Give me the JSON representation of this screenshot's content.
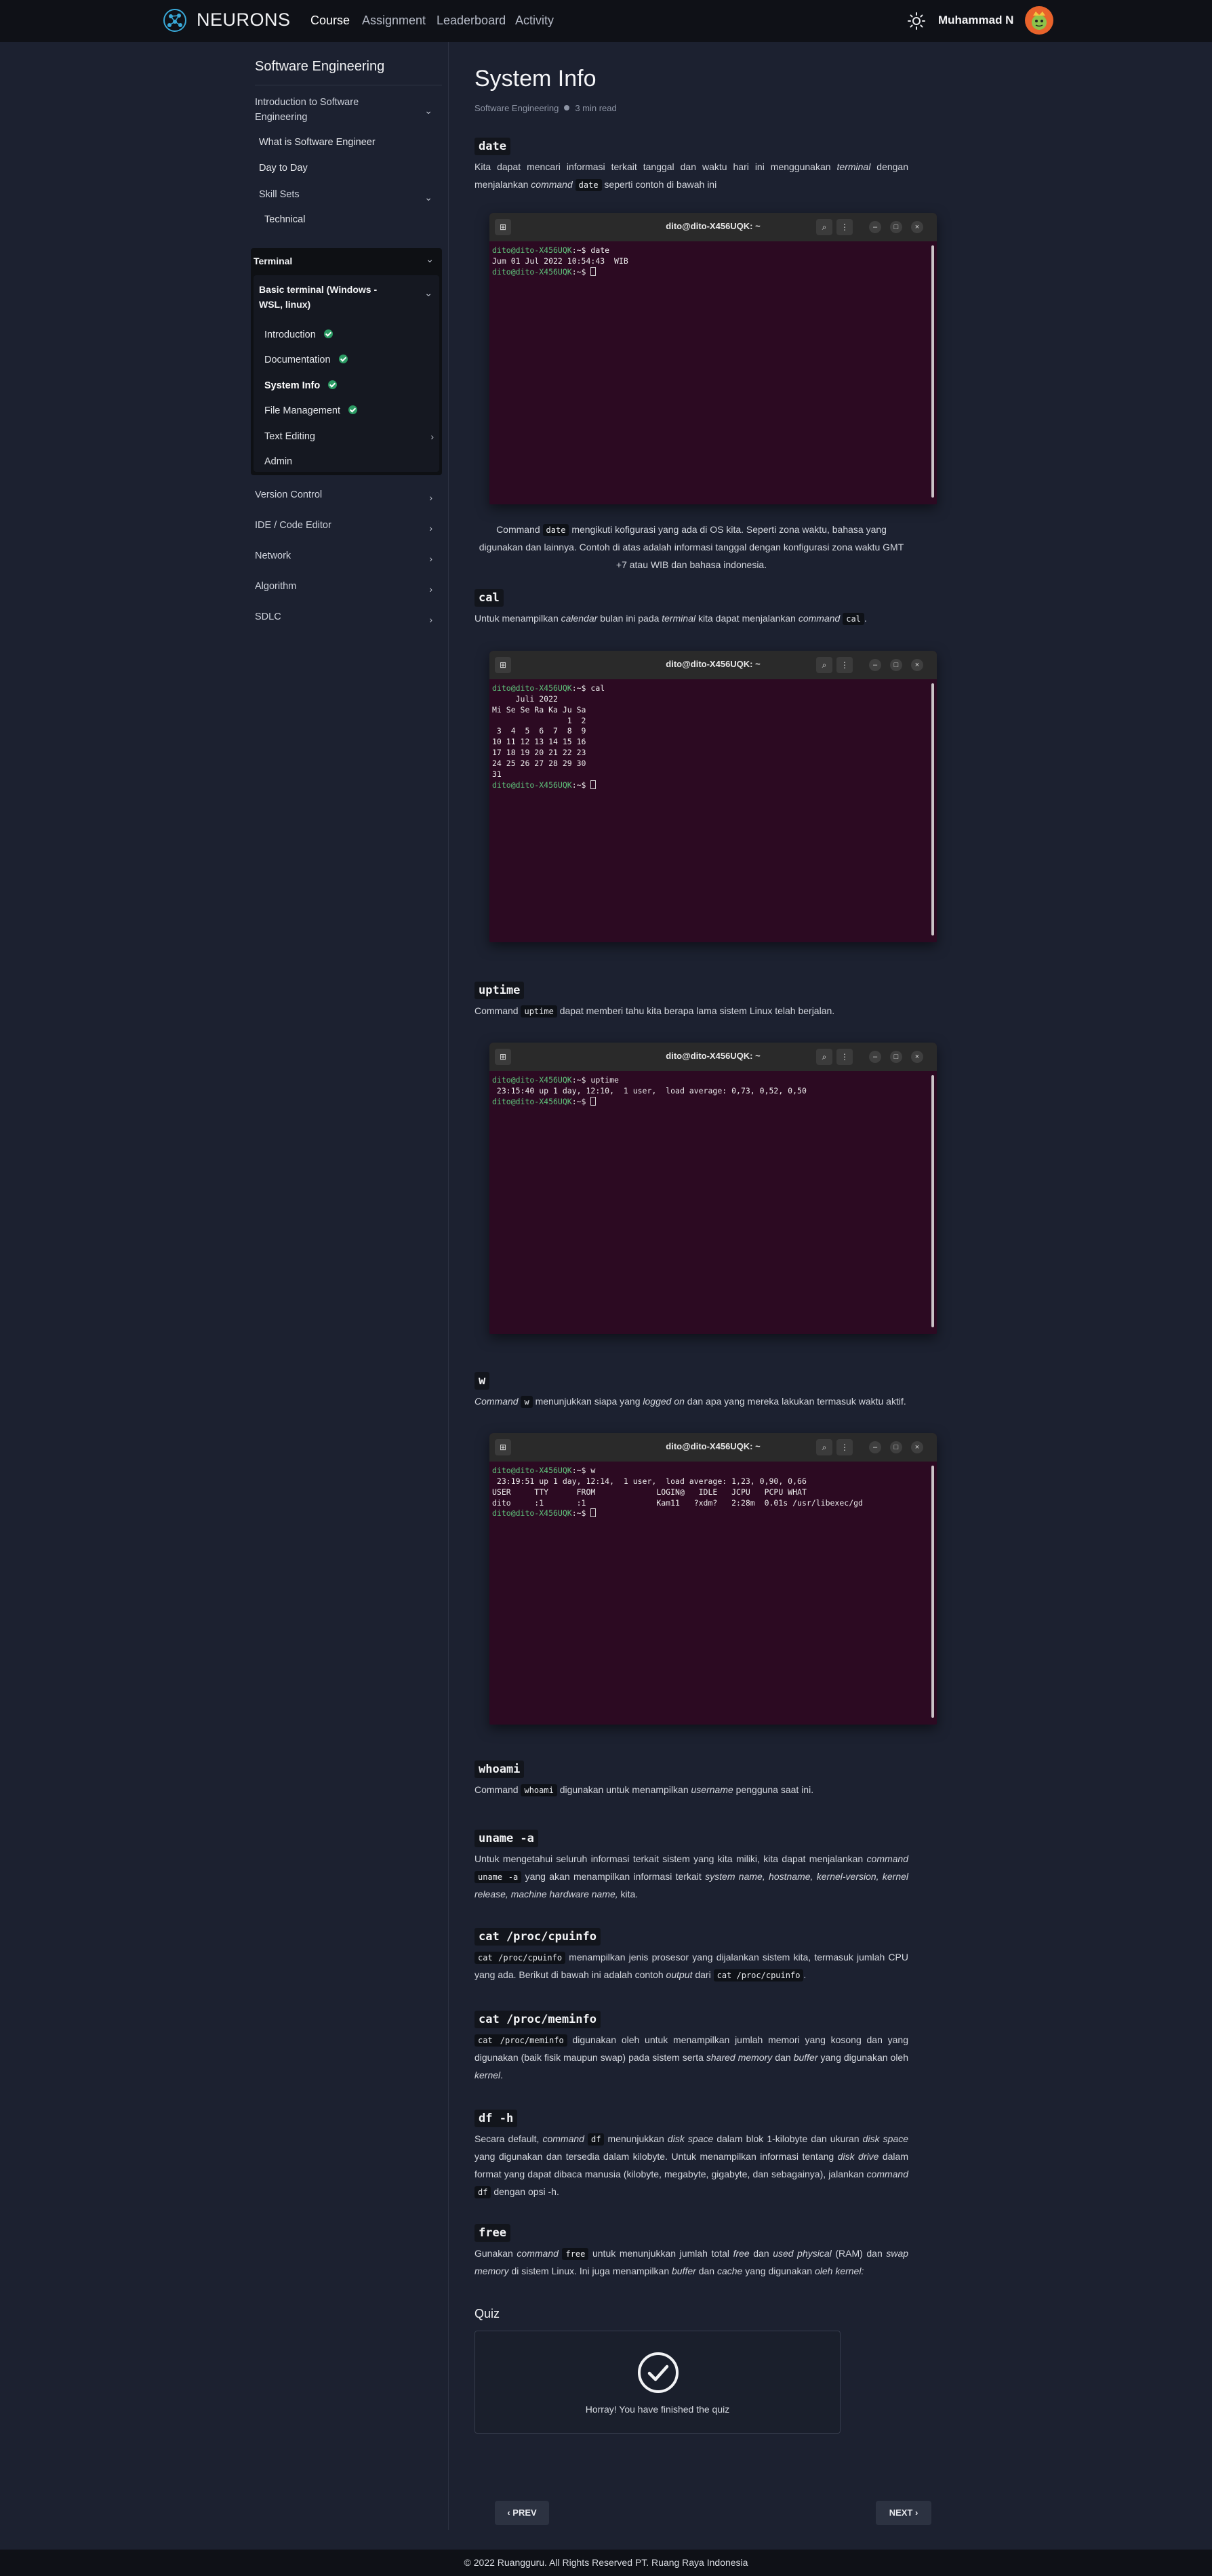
{
  "nav": {
    "brand": "NEURONS",
    "links": [
      "Course",
      "Assignment",
      "Leaderboard",
      "Activity"
    ],
    "user_name": "Muhammad N"
  },
  "sidebar": {
    "title": "Software Engineering",
    "sections": [
      {
        "label": "Introduction to Software Engineering",
        "expanded": true,
        "children": [
          "What is Software Engineer",
          "Day to Day",
          "Skill Sets",
          "Technical"
        ]
      },
      {
        "label": "Terminal",
        "expanded": true
      },
      {
        "label": "Version Control"
      },
      {
        "label": "IDE / Code Editor"
      },
      {
        "label": "Network"
      },
      {
        "label": "Algorithm"
      },
      {
        "label": "SDLC"
      }
    ],
    "terminal_group": "Basic terminal (Windows -WSL, linux)",
    "terminal_items": [
      {
        "label": "Introduction",
        "done": true
      },
      {
        "label": "Documentation",
        "done": true
      },
      {
        "label": "System Info",
        "done": true,
        "active": true
      },
      {
        "label": "File Management",
        "done": true
      },
      {
        "label": "Text Editing",
        "has_children": true
      },
      {
        "label": "Admin"
      }
    ]
  },
  "page": {
    "title": "System Info",
    "breadcrumb": "Software Engineering",
    "read_time": "3 min read"
  },
  "sections": {
    "date": {
      "heading": "date",
      "intro_a": "Kita dapat mencari informasi terkait tanggal dan waktu hari ini menggunakan ",
      "intro_em": "terminal",
      "intro_b": " dengan menjalankan ",
      "intro_em2": "command",
      "intro_code": "date",
      "intro_c": " seperti contoh di bawah ini",
      "caption_a": "Command ",
      "caption_code": "date",
      "caption_b": " mengikuti kofigurasi yang ada di OS kita. Seperti zona waktu, bahasa yang digunakan dan lainnya. Contoh di atas adalah informasi tanggal dengan konfigurasi zona waktu GMT +7 atau WIB dan bahasa indonesia."
    },
    "cal": {
      "heading": "cal",
      "text_a": "Untuk menampilkan ",
      "text_em": "calendar",
      "text_b": " bulan ini pada ",
      "text_em2": "terminal",
      "text_c": " kita dapat menjalankan ",
      "text_em3": "command",
      "text_code": "cal",
      "text_d": "."
    },
    "uptime": {
      "heading": "uptime",
      "text_a": "Command ",
      "text_code": "uptime",
      "text_b": " dapat memberi tahu kita berapa lama sistem Linux telah berjalan."
    },
    "w": {
      "heading": "w",
      "text_em": "Command",
      "text_code": "w",
      "text_a": " menunjukkan siapa yang ",
      "text_em2": "logged on",
      "text_b": " dan apa yang mereka lakukan termasuk waktu aktif."
    },
    "whoami": {
      "heading": "whoami",
      "text_a": "Command ",
      "text_code": "whoami",
      "text_b": " digunakan untuk menampilkan ",
      "text_em": "username",
      "text_c": " pengguna saat ini."
    },
    "uname": {
      "heading": "uname -a",
      "text_a": "Untuk mengetahui seluruh informasi terkait sistem yang kita miliki, kita dapat menjalankan ",
      "text_em": "command",
      "text_code": "uname -a",
      "text_b": " yang akan menampilkan informasi terkait ",
      "text_em2": "system name, hostname, kernel-version, kernel release, machine hardware name,",
      "text_c": " kita."
    },
    "cpuinfo": {
      "heading": "cat /proc/cpuinfo",
      "text_code": "cat /proc/cpuinfo",
      "text_a": " menampilkan jenis prosesor yang dijalankan sistem kita, termasuk jumlah CPU yang ada. Berikut di bawah ini adalah contoh ",
      "text_em": "output",
      "text_b": " dari ",
      "text_code2": "cat /proc/cpuinfo",
      "text_c": "."
    },
    "meminfo": {
      "heading": "cat /proc/meminfo",
      "text_code": "cat /proc/meminfo",
      "text_a": " digunakan oleh untuk menampilkan jumlah memori yang kosong dan yang digunakan (baik fisik maupun swap) pada sistem serta ",
      "text_em": "shared memory",
      "text_b": " dan ",
      "text_em2": "buffer",
      "text_c": " yang digunakan oleh ",
      "text_em3": "kernel",
      "text_d": "."
    },
    "df": {
      "heading": "df -h",
      "text_a": "Secara default, ",
      "text_em": "command",
      "text_code": "df",
      "text_b": " menunjukkan ",
      "text_em2": "disk space",
      "text_c": " dalam blok 1-kilobyte dan ukuran ",
      "text_em3": "disk space",
      "text_d": " yang digunakan dan tersedia dalam kilobyte. Untuk menampilkan informasi tentang ",
      "text_em4": "disk drive",
      "text_e": " dalam format yang dapat dibaca manusia (kilobyte, megabyte, gigabyte, dan sebagainya), jalankan ",
      "text_em5": "command",
      "text_code2": "df",
      "text_f": " dengan opsi -h."
    },
    "free": {
      "heading": "free",
      "text_a": "Gunakan ",
      "text_em": "command",
      "text_code": "free",
      "text_b": " untuk menunjukkan jumlah total ",
      "text_em2": "free",
      "text_c": " dan ",
      "text_em3": "used physical",
      "text_d": " (RAM) dan ",
      "text_em4": "swap memory",
      "text_e": " di sistem Linux. Ini juga menampilkan ",
      "text_em5": "buffer",
      "text_f": " dan ",
      "text_em6": "cache",
      "text_g": " yang digunakan ",
      "text_em7": "oleh kernel:"
    }
  },
  "terminals": {
    "title": "dito@dito-X456UQK: ~",
    "prompt": "dito@dito-X456UQK",
    "date_cmd": "date",
    "date_out": "Jum 01 Jul 2022 10:54:43  WIB",
    "cal_cmd": "cal",
    "cal_out": "     Juli 2022\nMi Se Se Ra Ka Ju Sa\n                1  2\n 3  4  5  6  7  8  9\n10 11 12 13 14 15 16\n17 18 19 20 21 22 23\n24 25 26 27 28 29 30\n31",
    "uptime_cmd": "uptime",
    "uptime_out": " 23:15:40 up 1 day, 12:10,  1 user,  load average: 0,73, 0,52, 0,50",
    "w_cmd": "w",
    "w_out": " 23:19:51 up 1 day, 12:14,  1 user,  load average: 1,23, 0,90, 0,66\nUSER     TTY      FROM             LOGIN@   IDLE   JCPU   PCPU WHAT\ndito     :1       :1               Kam11   ?xdm?   2:28m  0.01s /usr/libexec/gd"
  },
  "quiz": {
    "label": "Quiz",
    "message": "Horray! You have finished the quiz"
  },
  "pager": {
    "prev": "‹ PREV",
    "next": "NEXT ›"
  },
  "footer": "© 2022 Ruangguru. All Rights Reserved PT. Ruang Raya Indonesia",
  "colors": {
    "page_bg": "#1c2130",
    "topbar_bg": "#0f1117",
    "terminal_bg": "#2c0a22",
    "prompt_green": "#5fc37b",
    "check_green": "#2c9b64"
  }
}
